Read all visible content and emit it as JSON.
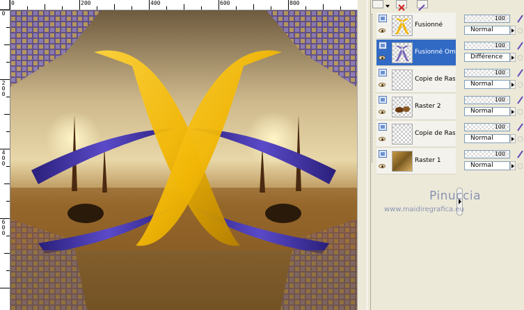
{
  "ruler": {
    "top_labels": [
      "0",
      "200",
      "400",
      "600",
      "800"
    ],
    "left_labels": [
      "0",
      "2",
      "0",
      "0",
      "4",
      "0",
      "0",
      "6",
      "0",
      "0"
    ]
  },
  "canvas": {
    "description_colors": {
      "gold": "#f2b705",
      "violet": "#4a3aa8",
      "bronze": "#8a5a22",
      "sky": "#d9c89a"
    }
  },
  "layers": [
    {
      "name": "Fusionné",
      "selected": false,
      "thumb": "gold-x"
    },
    {
      "name": "Fusionné Omb",
      "selected": true,
      "thumb": "violet-x"
    },
    {
      "name": "Copie de Rast",
      "selected": false,
      "thumb": "transparent-grid"
    },
    {
      "name": "Raster 2",
      "selected": false,
      "thumb": "rocks"
    },
    {
      "name": "Copie de Rast",
      "selected": false,
      "thumb": "transparent"
    },
    {
      "name": "Raster 1",
      "selected": false,
      "thumb": "gold-texture"
    }
  ],
  "props": [
    {
      "opacity": "100",
      "blend": "Normal"
    },
    {
      "opacity": "100",
      "blend": "Différence"
    },
    {
      "opacity": "100",
      "blend": "Normal"
    },
    {
      "opacity": "100",
      "blend": "Normal"
    },
    {
      "opacity": "100",
      "blend": "Normal"
    },
    {
      "opacity": "100",
      "blend": "Normal"
    }
  ],
  "watermark": {
    "name": "Pinuccia",
    "url": "www.maidiregrafica.eu"
  },
  "colors": {
    "selection": "#316ac5",
    "panel": "#ece9d8",
    "watermark": "#8a93b3"
  }
}
